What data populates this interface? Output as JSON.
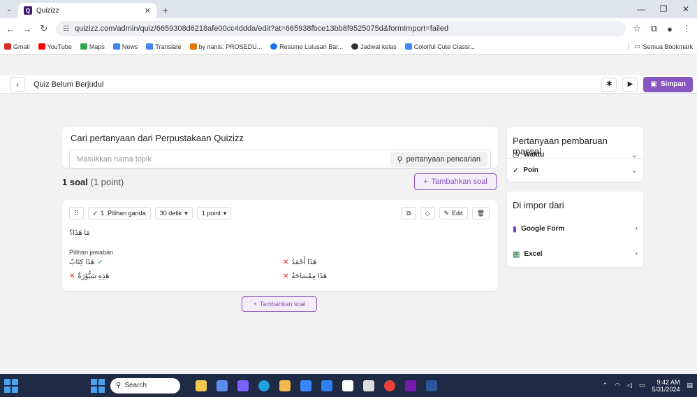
{
  "browser": {
    "tab_title": "Quizizz",
    "url": "quizizz.com/admin/quiz/6659308d6218afe00cc4ddda/edit?at=665938fbce13bb8f9525075d&formImport=failed",
    "bookmarks": [
      {
        "label": "Gmail",
        "color": "#d93025"
      },
      {
        "label": "YouTube",
        "color": "#ff0000"
      },
      {
        "label": "Maps",
        "color": "#34a853"
      },
      {
        "label": "News",
        "color": "#4285f4"
      },
      {
        "label": "Translate",
        "color": "#4285f4"
      },
      {
        "label": "by nanis: PROSEDU...",
        "color": "#e37400"
      },
      {
        "label": "Resume Lulusan Bar...",
        "color": "#1a73e8"
      },
      {
        "label": "Jadwal kelas",
        "color": "#333333"
      },
      {
        "label": "Colorful Cute Classr...",
        "color": "#4285f4"
      }
    ],
    "all_bookmarks": "Semua Bookmark"
  },
  "header": {
    "quiz_title": "Quiz Belum Berjudul",
    "save_label": "Simpan"
  },
  "search": {
    "title": "Cari pertanyaan dari Perpustakaan Quizizz",
    "placeholder": "Masukkan nama topik",
    "button": "pertanyaan pencarian"
  },
  "summary": {
    "count": "1 soal",
    "points": "(1 point)",
    "add_question": "Tambahkan soal"
  },
  "question": {
    "type": "1. Pilihan ganda",
    "time": "30 detik",
    "points": "1 point",
    "edit": "Edit",
    "text": "مَا هَذَا؟",
    "answers_label": "Pilihan jawaban",
    "answers": [
      {
        "text": "هَذَا كِتَابٌ",
        "correct": true
      },
      {
        "text": "هَذَا أَحْمَدُ",
        "correct": false
      },
      {
        "text": "هَذِهِ سَبُّوْرَةٌ",
        "correct": false
      },
      {
        "text": "هَذَا مِمْسَاحَةٌ",
        "correct": false
      }
    ],
    "add_question": "Tambahkan soal"
  },
  "bulk_update": {
    "title": "Pertanyaan pembaruan massal",
    "rows": [
      "Waktu",
      "Poin"
    ]
  },
  "import": {
    "title": "Di impor dari",
    "rows": [
      "Google Form",
      "Excel"
    ]
  },
  "taskbar": {
    "search": "Search",
    "time": "9:42 AM",
    "date": "5/31/2024"
  },
  "colors": {
    "accent": "#8854c0",
    "correct": "#1ea24b",
    "wrong": "#d92626"
  }
}
